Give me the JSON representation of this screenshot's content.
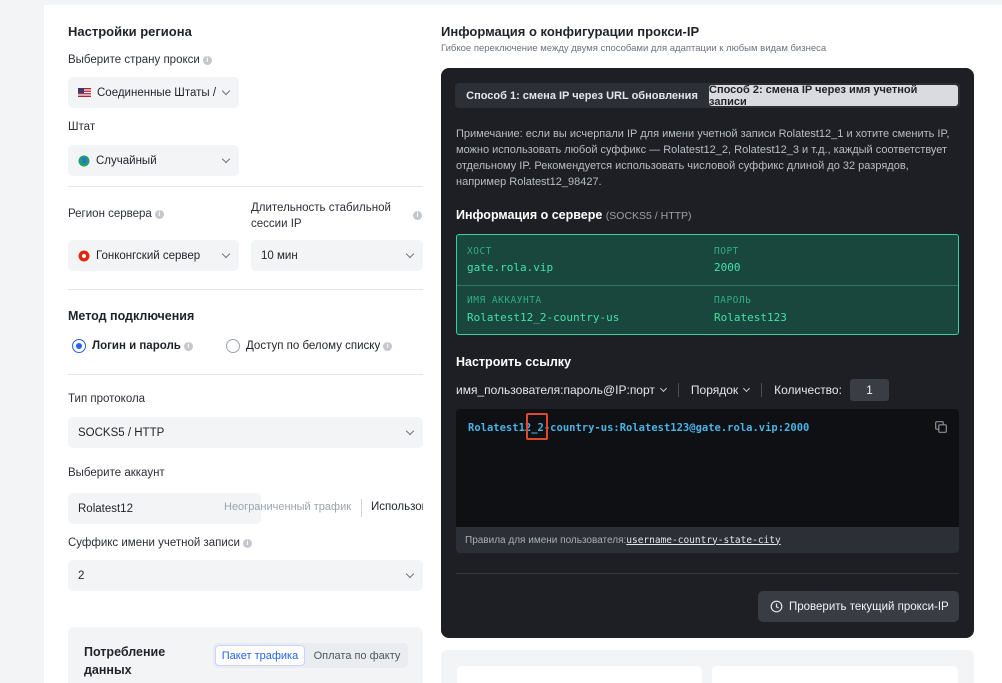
{
  "left": {
    "region_title": "Настройки региона",
    "country_label": "Выберите страну прокси",
    "country_value": "Соединенные Штаты /",
    "state_label": "Штат",
    "state_value": "Случайный",
    "server_region_label": "Регион сервера",
    "server_region_value": "Гонконгский сервер",
    "session_label": "Длительность стабильной сессии IP",
    "session_value": "10 мин",
    "method_title": "Метод подключения",
    "method_options": [
      "Логин и пароль",
      "Доступ по белому списку"
    ],
    "method_selected": "Логин и пароль",
    "protocol_label": "Тип протокола",
    "protocol_value": "SOCKS5 / HTTP",
    "account_label": "Выберите аккаунт",
    "account_name": "Rolatest12",
    "account_traffic": "Неограниченный трафик",
    "account_used": "Использовано",
    "suffix_label": "Суффикс имени учетной записи",
    "suffix_value": "2",
    "consumption_title": "Потребление данных",
    "consumption_tabs": [
      "Пакет трафика",
      "Оплата по факту"
    ]
  },
  "right": {
    "title": "Информация о конфигурации прокси-IP",
    "subtitle": "Гибкое переключение между двумя способами для адаптации к любым видам бизнеса",
    "tabs": [
      "Способ 1: смена IP через URL обновления",
      "Способ 2: смена IP через имя учетной записи"
    ],
    "active_tab": "Способ 2: смена IP через имя учетной записи",
    "note": "Примечание: если вы исчерпали IP для имени учетной записи Rolatest12_1 и хотите сменить IP, можно использовать любой суффикс — Rolatest12_2, Rolatest12_3 и т.д., каждый соответствует отдельному IP. Рекомендуется использовать числовой суффикс длиной до 32 разрядов, например Rolatest12_98427.",
    "server_info_title": "Информация о сервере",
    "server_info_protocol": "(SOCKS5 / HTTP)",
    "server": {
      "host_label": "ХОСТ",
      "host": "gate.rola.vip",
      "port_label": "ПОРТ",
      "port": "2000",
      "account_label": "ИМЯ АККАУНТА",
      "account": "Rolatest12_2-country-us",
      "password_label": "ПАРОЛЬ",
      "password": "Rolatest123"
    },
    "configure_title": "Настроить ссылку",
    "format": "имя_пользователя:пароль@IP:порт",
    "order_label": "Порядок",
    "quantity_label": "Количество:",
    "quantity": "1",
    "link": "Rolatest12_2-country-us:Rolatest123@gate.rola.vip:2000",
    "rules_label": "Правила для имени пользователя:",
    "rules_value": "username-country-state-city",
    "check_button": "Проверить текущий прокси-IP"
  },
  "colors": {
    "accent": "#2563eb",
    "dark_panel": "#1d1f24",
    "server_box": "#19473d",
    "server_text": "#43e3a8",
    "link_text": "#4ab3e6",
    "highlight": "#e0482d"
  }
}
